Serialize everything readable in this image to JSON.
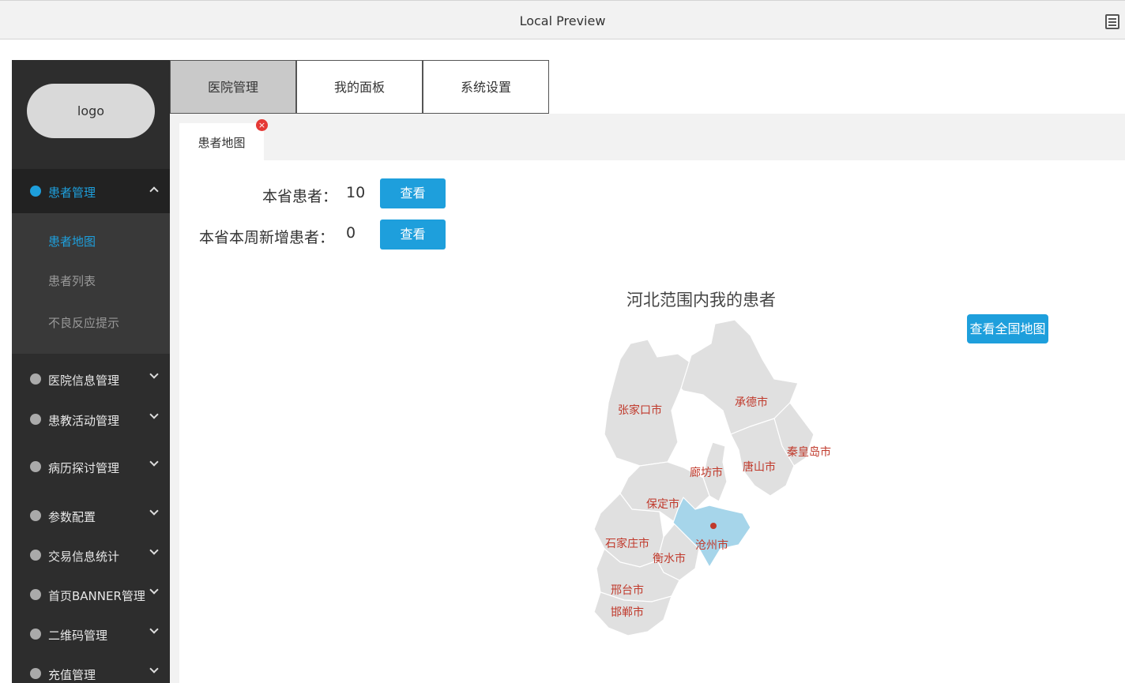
{
  "window": {
    "title": "Local Preview"
  },
  "sidebar": {
    "logo": "logo",
    "groups": [
      {
        "label": "患者管理",
        "active": true
      },
      {
        "label": "医院信息管理"
      },
      {
        "label": "患教活动管理"
      },
      {
        "label": "病历探讨管理"
      },
      {
        "label": "参数配置"
      },
      {
        "label": "交易信息统计"
      },
      {
        "label": "首页BANNER管理"
      },
      {
        "label": "二维码管理"
      },
      {
        "label": "充值管理"
      }
    ],
    "submenu": [
      {
        "label": "患者地图",
        "active": true
      },
      {
        "label": "患者列表"
      },
      {
        "label": "不良反应提示"
      }
    ]
  },
  "main_tabs": [
    {
      "label": "医院管理",
      "active": true
    },
    {
      "label": "我的面板"
    },
    {
      "label": "系统设置"
    }
  ],
  "page_tab": {
    "label": "患者地图",
    "close": "×"
  },
  "stats": {
    "province_patients": {
      "label": "本省患者：",
      "value": "10",
      "button": "查看"
    },
    "weekly_new": {
      "label": "本省本周新增患者：",
      "value": "0",
      "button": "查看"
    }
  },
  "map": {
    "title": "河北范围内我的患者",
    "national_button": "查看全国地图",
    "highlight_color": "#a6d5ea",
    "region_color": "#e0e0e0",
    "cities": [
      {
        "name": "张家口市"
      },
      {
        "name": "承德市"
      },
      {
        "name": "秦皇岛市"
      },
      {
        "name": "唐山市"
      },
      {
        "name": "廊坊市"
      },
      {
        "name": "保定市"
      },
      {
        "name": "沧州市",
        "highlighted": true
      },
      {
        "name": "石家庄市"
      },
      {
        "name": "衡水市"
      },
      {
        "name": "邢台市"
      },
      {
        "name": "邯郸市"
      }
    ]
  }
}
